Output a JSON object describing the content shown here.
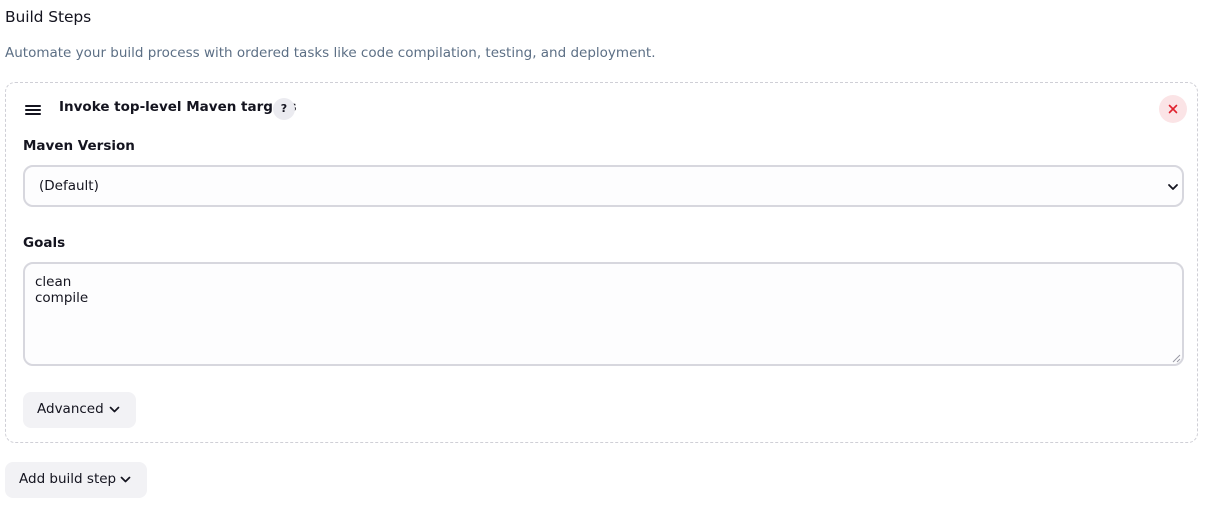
{
  "section": {
    "title": "Build Steps",
    "description": "Automate your build process with ordered tasks like code compilation, testing, and deployment."
  },
  "step": {
    "title": "Invoke top-level Maven targets",
    "help_icon": "?",
    "drag_icon": "hamburger-icon",
    "close_icon": "close-icon",
    "maven_version": {
      "label": "Maven Version",
      "selected": "(Default)"
    },
    "goals": {
      "label": "Goals",
      "lines": [
        "clean",
        "compile"
      ]
    },
    "advanced_label": "Advanced"
  },
  "add_step_label": "Add build step",
  "colors": {
    "text": "#14141f",
    "muted": "#5c6f85",
    "close_bg": "#fbe4e6",
    "close_x": "#e0222e",
    "button_bg": "#f2f2f5"
  }
}
